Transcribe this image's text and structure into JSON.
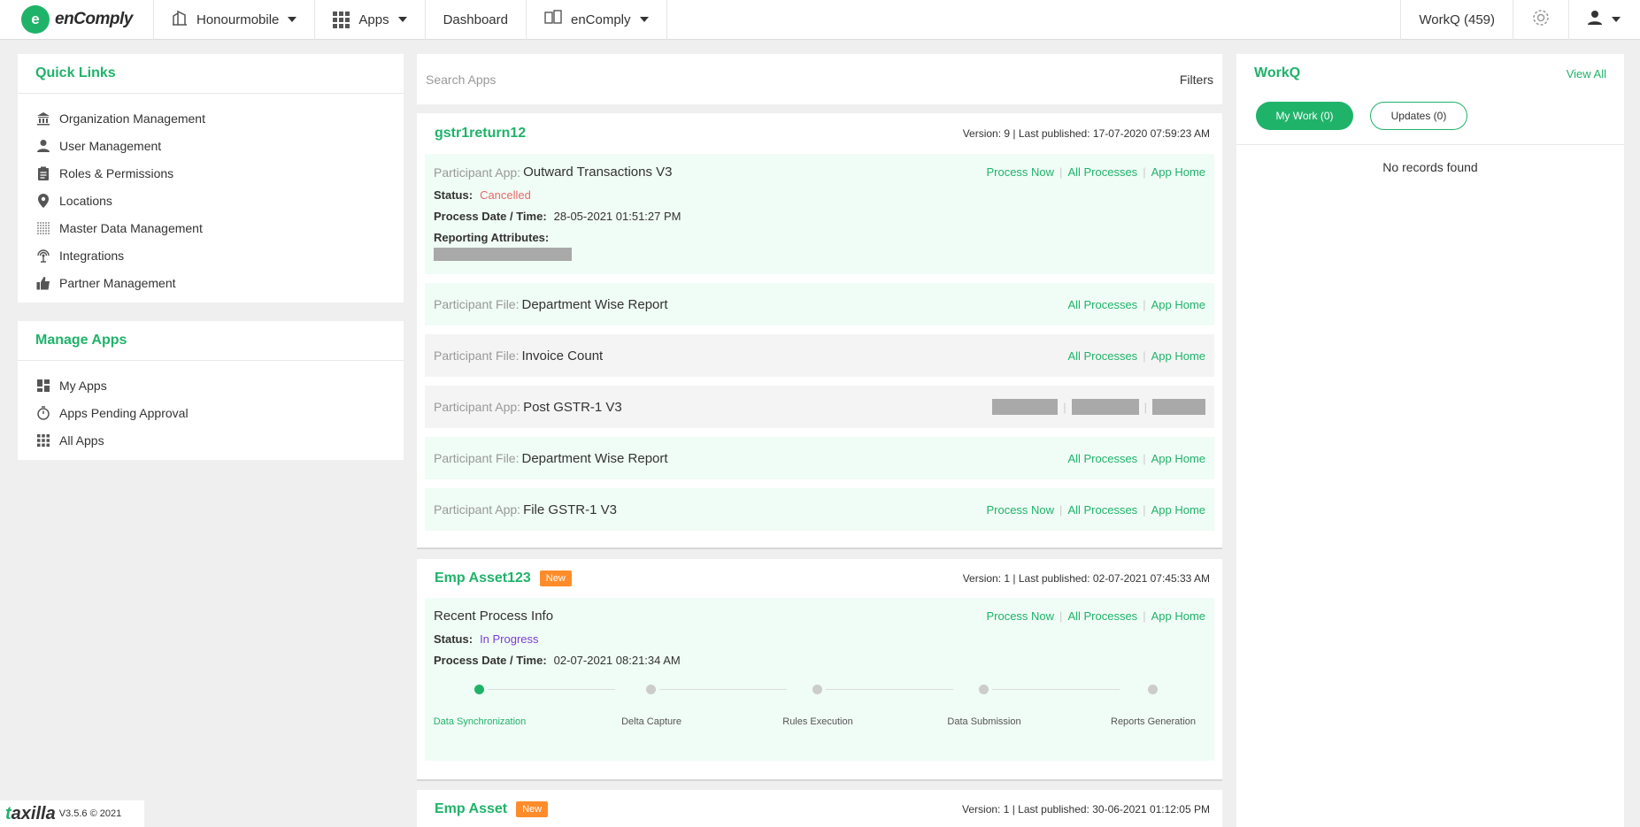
{
  "brand": {
    "logo_text": "enComply",
    "logo_mark": "e"
  },
  "topbar": {
    "org": "Honourmobile",
    "apps": "Apps",
    "dashboard": "Dashboard",
    "product": "enComply",
    "workq": "WorkQ (459)"
  },
  "quick_links": {
    "title": "Quick Links",
    "items": [
      {
        "label": "Organization Management",
        "icon": "bank-icon"
      },
      {
        "label": "User Management",
        "icon": "user-icon"
      },
      {
        "label": "Roles & Permissions",
        "icon": "clipboard-icon"
      },
      {
        "label": "Locations",
        "icon": "location-pin-icon"
      },
      {
        "label": "Master Data Management",
        "icon": "table-icon"
      },
      {
        "label": "Integrations",
        "icon": "antenna-icon"
      },
      {
        "label": "Partner Management",
        "icon": "thumbs-up-icon"
      }
    ]
  },
  "manage_apps": {
    "title": "Manage Apps",
    "items": [
      {
        "label": "My Apps",
        "icon": "dashboard-icon"
      },
      {
        "label": "Apps Pending Approval",
        "icon": "timer-icon"
      },
      {
        "label": "All Apps",
        "icon": "apps-grid-icon"
      }
    ]
  },
  "search": {
    "placeholder": "Search Apps",
    "filters": "Filters"
  },
  "links": {
    "process_now": "Process Now",
    "all_processes": "All Processes",
    "app_home": "App Home"
  },
  "card1": {
    "title": "gstr1return12",
    "meta": "Version: 9 | Last published: 17-07-2020 07:59:23 AM",
    "main": {
      "label": "Participant App:",
      "value": "Outward Transactions V3",
      "status_label": "Status:",
      "status": "Cancelled",
      "date_label": "Process Date / Time:",
      "date": "28-05-2021 01:51:27 PM",
      "reporting_label": "Reporting Attributes:"
    },
    "rows": [
      {
        "label": "Participant File:",
        "value": "Department Wise Report"
      },
      {
        "label": "Participant File:",
        "value": "Invoice Count"
      },
      {
        "label": "Participant App:",
        "value": "Post GSTR-1 V3"
      },
      {
        "label": "Participant File:",
        "value": "Department Wise Report"
      },
      {
        "label": "Participant App:",
        "value": "File GSTR-1 V3"
      }
    ]
  },
  "card2": {
    "title": "Emp Asset123",
    "badge": "New",
    "meta": "Version: 1 | Last published: 02-07-2021 07:45:33 AM",
    "recent": "Recent Process Info",
    "status_label": "Status:",
    "status": "In Progress",
    "date_label": "Process Date / Time:",
    "date": "02-07-2021 08:21:34 AM",
    "steps": [
      "Data Synchronization",
      "Delta Capture",
      "Rules Execution",
      "Data Submission",
      "Reports Generation"
    ]
  },
  "card3": {
    "title": "Emp Asset",
    "badge": "New",
    "meta": "Version: 1 | Last published: 30-06-2021 01:12:05 PM"
  },
  "workq_panel": {
    "title": "WorkQ",
    "view_all": "View All",
    "my_work": "My Work (0)",
    "updates": "Updates (0)",
    "empty": "No records found"
  },
  "footer": {
    "brand_prefix": "t",
    "brand_rest": "axilla",
    "version": "V3.5.6 © 2021"
  },
  "colors": {
    "accent": "#1fb36a",
    "badge": "#ff8c2a",
    "cancelled": "#e96a6a",
    "in_progress": "#7b3fd8"
  }
}
